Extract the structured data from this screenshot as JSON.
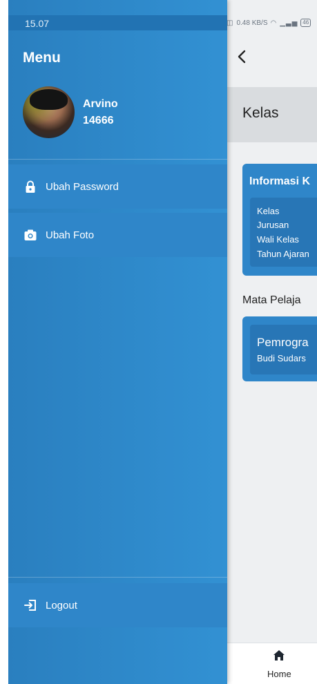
{
  "status_bar": {
    "time": "15.07",
    "right_indicators": "0.48 KB/S",
    "battery": "46"
  },
  "drawer": {
    "title": "Menu",
    "user": {
      "name": "Arvino",
      "id": "14666"
    },
    "items": [
      {
        "label": "Ubah Password",
        "icon": "lock-icon"
      },
      {
        "label": "Ubah Foto",
        "icon": "camera-icon"
      }
    ],
    "logout": {
      "label": "Logout",
      "icon": "logout-icon"
    }
  },
  "app": {
    "back_icon": "chevron-left-icon",
    "title": "Kelas",
    "info_card": {
      "title": "Informasi K",
      "lines": [
        "Kelas",
        "Jurusan",
        "Wali Kelas",
        "Tahun Ajaran"
      ]
    },
    "section_label": "Mata Pelaja",
    "subject": {
      "name": "Pemrogra",
      "teacher": "Budi Sudars"
    },
    "bottom_nav": {
      "home_label": "Home",
      "home_icon": "home-icon"
    }
  },
  "colors": {
    "drawer": "#3291d3",
    "card": "#2f86c9",
    "background": "#eef0f2"
  }
}
